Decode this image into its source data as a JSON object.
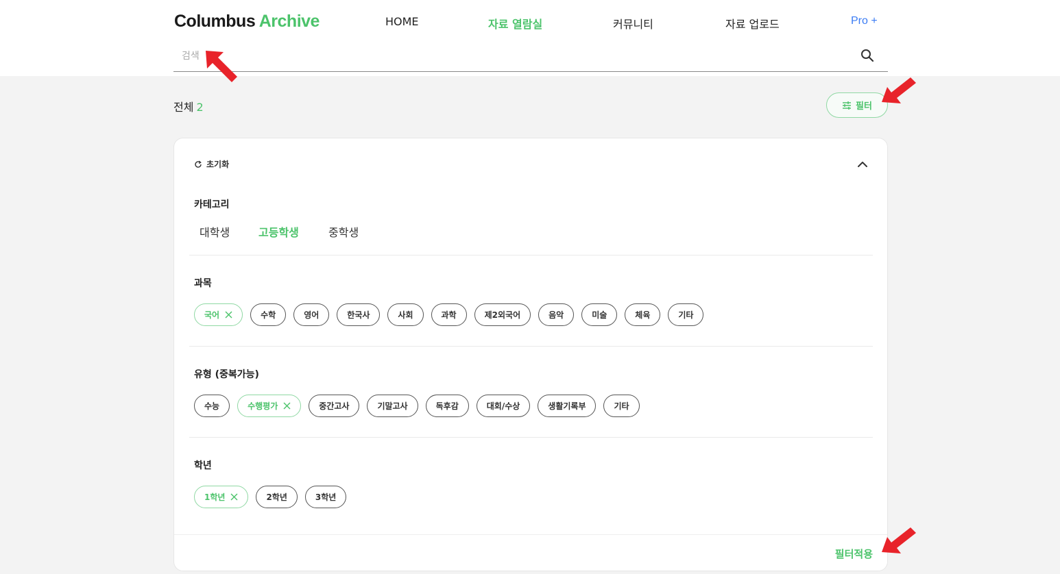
{
  "brand": {
    "logo_main": "Columbus",
    "logo_accent": "Archive"
  },
  "nav": {
    "items": [
      {
        "label": "HOME"
      },
      {
        "label": "자료 열람실"
      },
      {
        "label": "커뮤니티"
      },
      {
        "label": "자료 업로드"
      },
      {
        "label": "Pro +"
      }
    ],
    "active": "자료 열람실"
  },
  "search": {
    "placeholder": "검색",
    "value": ""
  },
  "results": {
    "total_label": "전체",
    "total_count": "2"
  },
  "filter_button": {
    "label": "필터"
  },
  "panel": {
    "reset_label": "초기화",
    "category": {
      "title": "카테고리",
      "tabs": [
        "대학생",
        "고등학생",
        "중학생"
      ],
      "selected": "고등학생"
    },
    "subject": {
      "title": "과목",
      "chips": [
        {
          "label": "국어",
          "selected": true
        },
        {
          "label": "수학",
          "selected": false
        },
        {
          "label": "영어",
          "selected": false
        },
        {
          "label": "한국사",
          "selected": false
        },
        {
          "label": "사회",
          "selected": false
        },
        {
          "label": "과학",
          "selected": false
        },
        {
          "label": "제2외국어",
          "selected": false
        },
        {
          "label": "음악",
          "selected": false
        },
        {
          "label": "미술",
          "selected": false
        },
        {
          "label": "체육",
          "selected": false
        },
        {
          "label": "기타",
          "selected": false
        }
      ]
    },
    "type": {
      "title": "유형 (중복가능)",
      "chips": [
        {
          "label": "수능",
          "selected": false
        },
        {
          "label": "수행평가",
          "selected": true
        },
        {
          "label": "중간고사",
          "selected": false
        },
        {
          "label": "기말고사",
          "selected": false
        },
        {
          "label": "독후감",
          "selected": false
        },
        {
          "label": "대회/수상",
          "selected": false
        },
        {
          "label": "생활기록부",
          "selected": false
        },
        {
          "label": "기타",
          "selected": false
        }
      ]
    },
    "grade": {
      "title": "학년",
      "chips": [
        {
          "label": "1학년",
          "selected": true
        },
        {
          "label": "2학년",
          "selected": false
        },
        {
          "label": "3학년",
          "selected": false
        }
      ]
    },
    "apply_label": "필터적용"
  },
  "icons": {
    "search": "search-icon",
    "filter": "sliders-icon",
    "reset": "refresh-icon",
    "collapse": "chevron-up-icon",
    "remove": "close-icon",
    "annotation": "red-arrow-icon"
  },
  "colors": {
    "accent": "#4cc36b",
    "pro": "#3b7cf4",
    "annotation": "#e8232a"
  }
}
